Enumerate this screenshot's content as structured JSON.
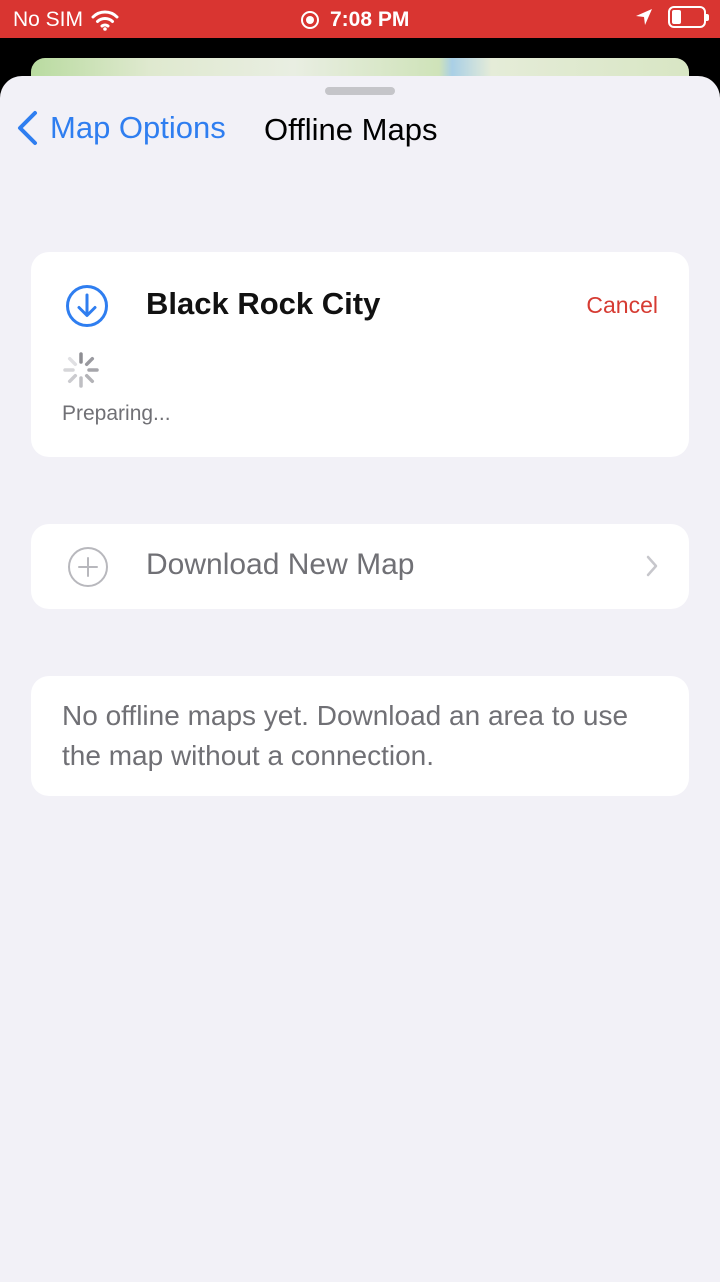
{
  "status_bar": {
    "carrier": "No SIM",
    "time": "7:08 PM",
    "background_color": "#d93531"
  },
  "nav": {
    "back_label": "Map Options",
    "title": "Offline Maps",
    "accent_color": "#2f7ef0"
  },
  "download": {
    "icon": "download-circle-icon",
    "name": "Black Rock City",
    "cancel_label": "Cancel",
    "status": "Preparing...",
    "cancel_color": "#d63b32"
  },
  "new_map": {
    "icon": "plus-circle-icon",
    "label": "Download New Map"
  },
  "empty_state": {
    "message": "No offline maps yet. Download an area to use the map without a connection."
  }
}
